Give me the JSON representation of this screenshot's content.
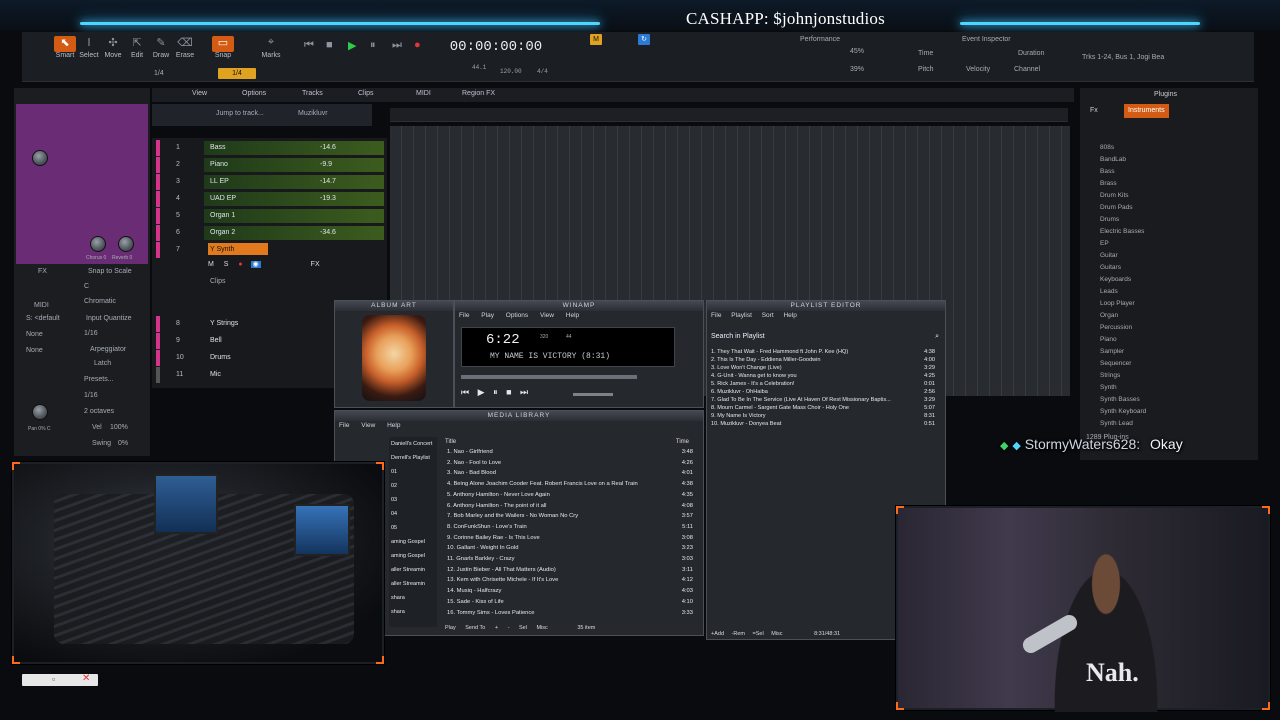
{
  "overlay": {
    "cashapp": "CASHAPP: $johnjonstudios"
  },
  "toolbar": {
    "tools": [
      "Smart",
      "Select",
      "Move",
      "Edit",
      "Draw",
      "Erase"
    ],
    "snap": "Snap",
    "snap_value": "1/4",
    "marks": "Marks",
    "timecode": "00:00:00:00",
    "tempo": "120.00",
    "time_sig": "4/4",
    "sample": "44.1",
    "performance_label": "Performance",
    "perf_cpu": "45%",
    "perf_disk": "39%",
    "event_inspector_label": "Event Inspector",
    "ei_fields": [
      "Time",
      "Duration",
      "Pitch",
      "Velocity",
      "Channel"
    ],
    "track_info": "Trks 1-24, Bus 1, Jogi Bea",
    "snap_quarter": "1/4"
  },
  "menubar": {
    "items": [
      "View",
      "Options",
      "Tracks",
      "Clips",
      "MIDI",
      "Region FX"
    ],
    "jump_placeholder": "Jump to track...",
    "project": "Muzikluvr"
  },
  "tracks": [
    {
      "num": "1",
      "name": "Bass",
      "vol": "-14.6",
      "color": "#d6338a"
    },
    {
      "num": "2",
      "name": "Piano",
      "vol": "-9.9",
      "color": "#d6338a"
    },
    {
      "num": "3",
      "name": "LL EP",
      "vol": "-14.7",
      "color": "#d6338a"
    },
    {
      "num": "4",
      "name": "UAD EP",
      "vol": "-19.3",
      "color": "#d6338a"
    },
    {
      "num": "5",
      "name": "Organ 1",
      "vol": "",
      "color": "#d6338a"
    },
    {
      "num": "6",
      "name": "Organ 2",
      "vol": "-34.6",
      "color": "#d6338a"
    },
    {
      "num": "7",
      "name": "Y Synth",
      "vol": "",
      "color": "#d6338a"
    },
    {
      "num": "8",
      "name": "Y Strings",
      "vol": "",
      "color": "#d6338a"
    },
    {
      "num": "9",
      "name": "Bell",
      "vol": "",
      "color": "#d6338a"
    },
    {
      "num": "10",
      "name": "Drums",
      "vol": "",
      "color": "#d6338a"
    },
    {
      "num": "11",
      "name": "Mic",
      "vol": "",
      "color": "#555"
    }
  ],
  "track_controls": {
    "m": "M",
    "s": "S",
    "clips": "Clips",
    "fx": "FX"
  },
  "inspector": {
    "snap_to_scale": "Snap to Scale",
    "key": "C",
    "scale": "Chromatic",
    "midi_label": "MIDI",
    "input_quantize": "Input Quantize",
    "quantize_value": "1/16",
    "arpeggiator": "Arpeggiator",
    "latch": "Latch",
    "presets": "Presets...",
    "rate": "1/16",
    "octaves": "2 octaves",
    "vel": "Vel",
    "vel_value": "100%",
    "swing": "Swing",
    "swing_value": "0%",
    "dropdown_default": "S: <default",
    "none1": "None",
    "none2": "None",
    "fx_label": "FX",
    "chorus": "Chorus 0",
    "reverb": "Reverb 0",
    "pan": "Pan 0% C"
  },
  "browser": {
    "tab_plugins": "Plugins",
    "tab_instruments": "Instruments",
    "tab_fx": "Fx",
    "items": [
      "808s",
      "BandLab",
      "Bass",
      "Brass",
      "Drum Kits",
      "Drum Pads",
      "Drums",
      "Electric Basses",
      "EP",
      "Guitar",
      "Guitars",
      "Keyboards",
      "Leads",
      "Loop Player",
      "Organ",
      "Percussion",
      "Piano",
      "Sampler",
      "Sequencer",
      "Strings",
      "Synth",
      "Synth Basses",
      "Synth Keyboard",
      "Synth Lead"
    ],
    "count": "1289 Plug-ins"
  },
  "winamp": {
    "album_art_title": "ALBUM ART",
    "main_title": "WINAMP",
    "menu": [
      "File",
      "Play",
      "Options",
      "View",
      "Help"
    ],
    "time": "6:22",
    "scroll": "MY NAME IS VICTORY (8:31)",
    "kbps": "320",
    "khz": "44"
  },
  "playlist": {
    "title": "PLAYLIST EDITOR",
    "menu": [
      "File",
      "Playlist",
      "Sort",
      "Help"
    ],
    "search": "Search in Playlist",
    "items": [
      {
        "n": "1. They That Wait - Fred Hammond ft John P. Kee (HQ)",
        "t": "4:38"
      },
      {
        "n": "2. This Is The Day - Eddiena Miller-Goodwin",
        "t": "4:00"
      },
      {
        "n": "3. Love Won't Change (Live)",
        "t": "3:29"
      },
      {
        "n": "4. G-Unit - Wanna get to know you",
        "t": "4:25"
      },
      {
        "n": "5. Rick James - It's a Celebration!",
        "t": "0:01"
      },
      {
        "n": "6. Muzikluvr - OhHaiba",
        "t": "2:56"
      },
      {
        "n": "7. Glad To Be In The Service (Live At Haven Of Rest Missionary Baptis...",
        "t": "3:29"
      },
      {
        "n": "8. Mourn Carmel - Sargent Gate Mass Choir - Holy One",
        "t": "5:07"
      },
      {
        "n": "9. My Name Is Victory",
        "t": "8:31"
      },
      {
        "n": "10. Muzikluvr - Donyea Beat",
        "t": "0:51"
      }
    ],
    "buttons": [
      "+Add",
      "-Rem",
      "=Sel",
      "Misc"
    ],
    "status": "8:31/48:31"
  },
  "media_library": {
    "title": "MEDIA LIBRARY",
    "menu": [
      "File",
      "View",
      "Help"
    ],
    "tree": [
      "Daniell's Concert",
      "Derrell's Playlist",
      "01",
      "02",
      "03",
      "04",
      "05",
      "aming Gospel",
      "aming Gospel",
      "aller Streamin",
      "aller Streamin",
      "shara",
      "shara"
    ],
    "col_title": "Title",
    "col_time": "Time",
    "songs": [
      {
        "n": "1. Nao - Girlfriend",
        "t": "3:48"
      },
      {
        "n": "2. Nao - Fool to Love",
        "t": "4:26"
      },
      {
        "n": "3. Nao - Bad Blood",
        "t": "4:01"
      },
      {
        "n": "4. Being Alone Joachim Cooder Feat. Robert Francis Love on a Real Train",
        "t": "4:38"
      },
      {
        "n": "5. Anthony Hamilton - Never Love Again",
        "t": "4:35"
      },
      {
        "n": "6. Anthony Hamilton - The point of it all",
        "t": "4:08"
      },
      {
        "n": "7. Bob Marley and the Wailers - No Woman No Cry",
        "t": "3:57"
      },
      {
        "n": "8. ConFunkShun - Love's Train",
        "t": "5:11"
      },
      {
        "n": "9. Corinne Bailey Rae - Is This Love",
        "t": "3:08"
      },
      {
        "n": "10. Gallant - Weight In Gold",
        "t": "3:23"
      },
      {
        "n": "11. Gnarls Barkley - Crazy",
        "t": "3:03"
      },
      {
        "n": "12. Justin Bieber - All That Matters (Audio)",
        "t": "3:11"
      },
      {
        "n": "13. Kem with Chrisette Michele - If It's Love",
        "t": "4:12"
      },
      {
        "n": "14. Musiq - Halfcrazy",
        "t": "4:03"
      },
      {
        "n": "15. Sade - Kiss of Life",
        "t": "4:10"
      },
      {
        "n": "16. Tommy Sims - Loves Patience",
        "t": "3:33"
      }
    ],
    "buttons": [
      "Play",
      "Send To",
      "+",
      "-",
      "Sel",
      "Misc"
    ],
    "count": "35 item"
  },
  "chat": {
    "user": "StormyWaters628:",
    "msg": "Okay"
  },
  "shirt_text": "Nah.",
  "colors": {
    "accent": "#d45b14",
    "glow": "#4fd6ff",
    "track_pink": "#d6338a"
  }
}
